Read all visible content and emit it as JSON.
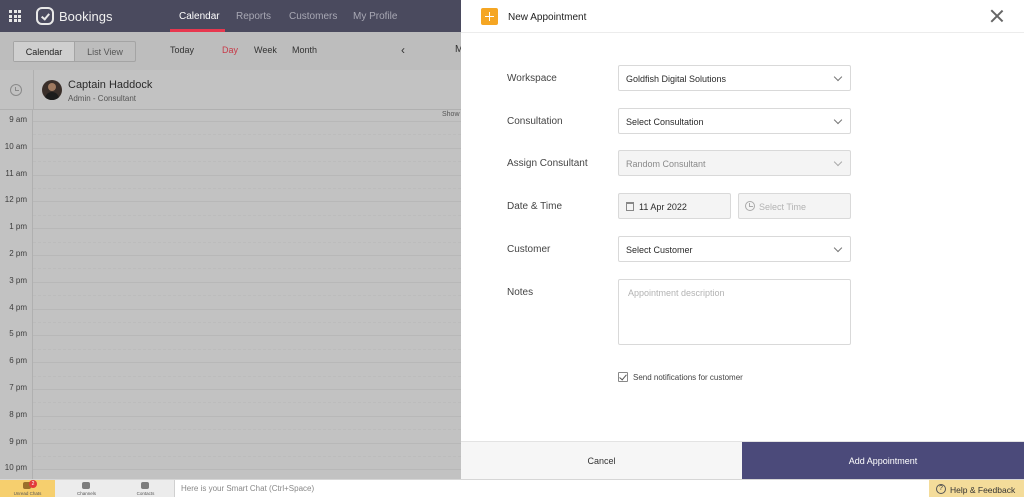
{
  "app": {
    "title": "Bookings"
  },
  "nav": [
    {
      "label": "Calendar"
    },
    {
      "label": "Reports"
    },
    {
      "label": "Customers"
    },
    {
      "label": "My Profile"
    }
  ],
  "toolbar": {
    "view_calendar": "Calendar",
    "view_list": "List View",
    "today": "Today",
    "day": "Day",
    "week": "Week",
    "month": "Month",
    "prev": "‹",
    "month_letter": "M"
  },
  "staff": {
    "name": "Captain Haddock",
    "role": "Admin - Consultant"
  },
  "calendar": {
    "show_text": "Show",
    "hours": [
      "9 am",
      "10 am",
      "11 am",
      "12 pm",
      "1 pm",
      "2 pm",
      "3 pm",
      "4 pm",
      "5 pm",
      "6 pm",
      "7 pm",
      "8 pm",
      "9 pm",
      "10 pm"
    ]
  },
  "modal": {
    "title": "New Appointment",
    "fields": {
      "workspace": {
        "label": "Workspace",
        "value": "Goldfish Digital Solutions"
      },
      "consultation": {
        "label": "Consultation",
        "value": "Select Consultation"
      },
      "consultant": {
        "label": "Assign Consultant",
        "value": "Random Consultant"
      },
      "datetime": {
        "label": "Date & Time",
        "date": "11 Apr 2022",
        "time_placeholder": "Select Time"
      },
      "customer": {
        "label": "Customer",
        "value": "Select Customer"
      },
      "notes": {
        "label": "Notes",
        "placeholder": "Appointment description"
      }
    },
    "notify_label": "Send notifications for customer",
    "notify_checked": true,
    "cancel_label": "Cancel",
    "submit_label": "Add Appointment"
  },
  "bottombar": {
    "items": [
      {
        "label": "Unread Chats",
        "badge": "2"
      },
      {
        "label": "Channels"
      },
      {
        "label": "Contacts"
      }
    ],
    "smart_chat_placeholder": "Here is your Smart Chat (Ctrl+Space)",
    "help_label": "Help & Feedback"
  },
  "colors": {
    "accent": "#e8384f",
    "primary_button": "#4b4a7a",
    "topbar": "#4a4a5e",
    "new_icon": "#f5a623"
  }
}
